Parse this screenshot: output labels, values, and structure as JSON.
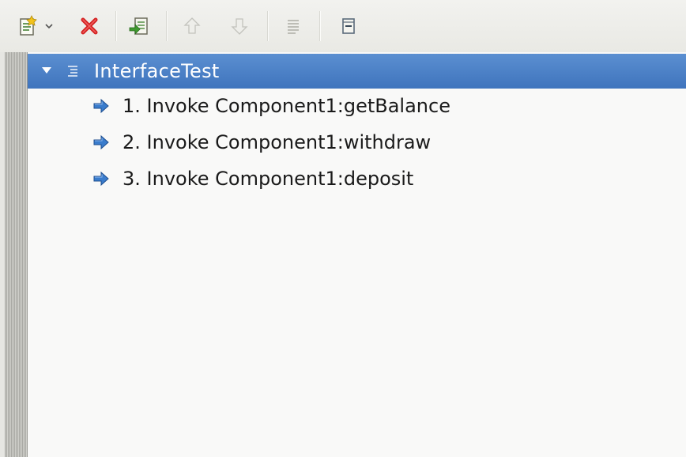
{
  "toolbar": {
    "buttons": [
      {
        "name": "add-step-dropdown",
        "icon": "new-step-icon"
      },
      {
        "name": "delete",
        "icon": "red-x-icon"
      },
      {
        "name": "import",
        "icon": "import-icon"
      },
      {
        "name": "move-up",
        "icon": "up-arrow-icon",
        "enabled": false
      },
      {
        "name": "move-down",
        "icon": "down-arrow-icon",
        "enabled": false
      },
      {
        "name": "properties",
        "icon": "list-icon",
        "enabled": false
      },
      {
        "name": "collapse-all",
        "icon": "collapse-icon"
      }
    ]
  },
  "tree": {
    "root": {
      "label": "InterfaceTest",
      "expanded": true,
      "selected": true
    },
    "steps": [
      {
        "label": "1. Invoke Component1:getBalance"
      },
      {
        "label": "2. Invoke Component1:withdraw"
      },
      {
        "label": "3. Invoke Component1:deposit"
      }
    ]
  },
  "colors": {
    "selection": "#4a80c8",
    "step_arrow": "#2f6fc0",
    "delete_red": "#d42020"
  }
}
